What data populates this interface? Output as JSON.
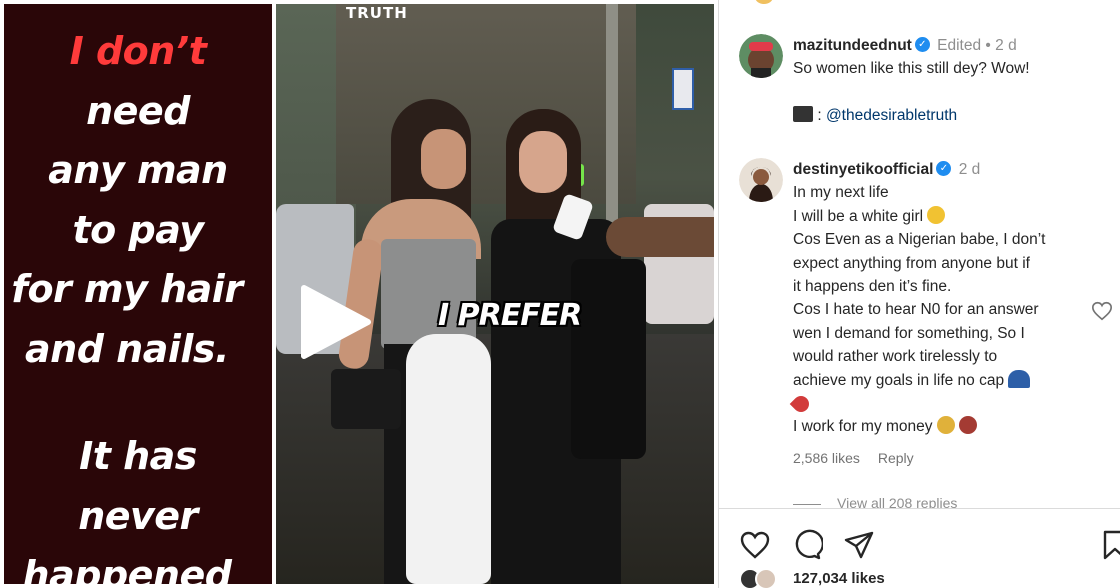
{
  "left_panel": {
    "lines": [
      "I don’t",
      "need",
      "any man",
      "to pay",
      "for my hair",
      "and nails.",
      "It has",
      "never",
      "happened"
    ]
  },
  "video": {
    "watermark": "TRUTH",
    "caption": "I PREFER",
    "play_icon": "play-icon"
  },
  "comments": [
    {
      "username": "mazitundeednut",
      "edited": "Edited",
      "dot": "•",
      "age": "2 d",
      "text_lines": [
        "So women like this still dey? Wow!"
      ],
      "credit_icon": "clapperboard-emoji",
      "mention": "@thedesirabletruth"
    },
    {
      "username": "destinyetikoofficial",
      "age": "2 d",
      "text_lines": [
        "In my next life",
        "I will be a white girl",
        "Cos Even as a Nigerian babe, I don’t",
        "expect anything from anyone but if",
        "it happens den it’s fine.",
        "Cos I hate to hear N0 for an answer",
        "wen I demand for something, So I",
        "would rather work tirelessly to",
        "achieve my goals in life no cap",
        "",
        "I work for my money"
      ],
      "likes": "2,586 likes",
      "reply": "Reply"
    }
  ],
  "view_replies": "View all 208 replies",
  "post_actions": {
    "icons": [
      "heart-icon",
      "comment-icon",
      "share-icon",
      "save-icon"
    ],
    "likes": "127,034 likes"
  },
  "colors": {
    "text_panel_bg": "#2a0608",
    "highlight_red": "#ff3b3b",
    "verified_blue": "#1f8df0",
    "link_blue": "#00376b",
    "meta_gray": "#8e8e8e"
  }
}
